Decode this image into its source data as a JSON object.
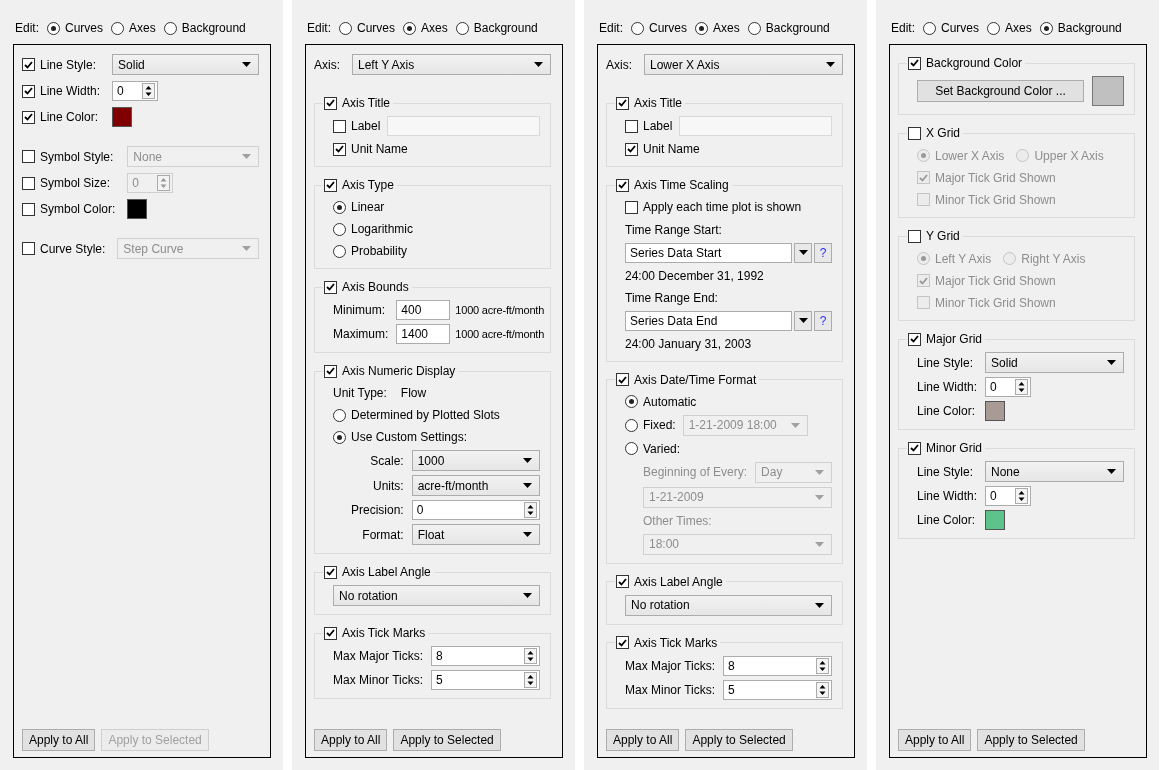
{
  "panels": [
    {
      "edit_label": "Edit:",
      "edit_options": [
        {
          "label": "Curves",
          "selected": true
        },
        {
          "label": "Axes",
          "selected": false
        },
        {
          "label": "Background",
          "selected": false
        }
      ],
      "blocks": [
        {
          "kind": "plain",
          "items": [
            {
              "kind": "dropdown",
              "label": "Line Style:",
              "checked": true,
              "value": "Solid",
              "disabled": false
            },
            {
              "kind": "spinner",
              "label": "Line Width:",
              "checked": true,
              "value": "0",
              "disabled": false
            },
            {
              "kind": "color",
              "label": "Line Color:",
              "checked": true,
              "color": "#800000",
              "disabled": false
            }
          ]
        },
        {
          "kind": "plain",
          "items": [
            {
              "kind": "dropdown",
              "label": "Symbol Style:",
              "checked": false,
              "value": "None",
              "disabled": true
            },
            {
              "kind": "spinner",
              "label": "Symbol Size:",
              "checked": false,
              "value": "0",
              "disabled": true
            },
            {
              "kind": "color",
              "label": "Symbol Color:",
              "checked": false,
              "color": "#000000",
              "disabled": false
            }
          ]
        },
        {
          "kind": "plain",
          "items": [
            {
              "kind": "dropdown",
              "label": "Curve Style:",
              "checked": false,
              "value": "Step Curve",
              "disabled": true
            }
          ]
        }
      ],
      "buttons": [
        {
          "label": "Apply to All",
          "disabled": false
        },
        {
          "label": "Apply to Selected",
          "disabled": true
        }
      ]
    },
    {
      "edit_label": "Edit:",
      "edit_options": [
        {
          "label": "Curves",
          "selected": false
        },
        {
          "label": "Axes",
          "selected": true
        },
        {
          "label": "Background",
          "selected": false
        }
      ],
      "blocks": [
        {
          "kind": "plain",
          "items": [
            {
              "kind": "dropdown",
              "label": "Axis:",
              "value": "Left Y Axis",
              "disabled": false
            }
          ]
        },
        {
          "kind": "group",
          "title": "Axis Title",
          "checked": true,
          "items": [
            {
              "kind": "check_field",
              "label": "Label",
              "checked": false,
              "disabled": false
            },
            {
              "kind": "check",
              "label": "Unit Name",
              "checked": true,
              "disabled": false
            }
          ]
        },
        {
          "kind": "group",
          "title": "Axis Type",
          "checked": true,
          "items": [
            {
              "kind": "radio",
              "label": "Linear",
              "selected": true,
              "disabled": false
            },
            {
              "kind": "radio",
              "label": "Logarithmic",
              "selected": false,
              "disabled": false
            },
            {
              "kind": "radio",
              "label": "Probability",
              "selected": false,
              "disabled": false
            }
          ]
        },
        {
          "kind": "group",
          "title": "Axis Bounds",
          "checked": true,
          "items": [
            {
              "kind": "bound",
              "label": "Minimum:",
              "value": "400",
              "unit": "1000 acre-ft/month",
              "disabled": false
            },
            {
              "kind": "bound",
              "label": "Maximum:",
              "value": "1400",
              "unit": "1000 acre-ft/month",
              "disabled": false
            }
          ]
        },
        {
          "kind": "group",
          "title": "Axis Numeric Display",
          "checked": true,
          "items": [
            {
              "kind": "info",
              "label": "Unit Type:",
              "value": "Flow",
              "disabled": false
            },
            {
              "kind": "radio",
              "label": "Determined by Plotted Slots",
              "selected": false,
              "disabled": false
            },
            {
              "kind": "radio",
              "label": "Use Custom Settings:",
              "selected": true,
              "disabled": false,
              "children": [
                {
                  "kind": "dropdown",
                  "label": "Scale:",
                  "value": "1000",
                  "disabled": false
                },
                {
                  "kind": "dropdown",
                  "label": "Units:",
                  "value": "acre-ft/month",
                  "disabled": false
                },
                {
                  "kind": "number_field",
                  "label": "Precision:",
                  "value": "0",
                  "disabled": false
                },
                {
                  "kind": "dropdown",
                  "label": "Format:",
                  "value": "Float",
                  "disabled": false
                }
              ]
            }
          ]
        },
        {
          "kind": "group",
          "title": "Axis Label Angle",
          "checked": true,
          "items": [
            {
              "kind": "dropdown",
              "value": "No rotation",
              "disabled": false
            }
          ]
        },
        {
          "kind": "group",
          "title": "Axis Tick Marks",
          "checked": true,
          "items": [
            {
              "kind": "number_field",
              "label": "Max Major Ticks:",
              "value": "8",
              "disabled": false
            },
            {
              "kind": "number_field",
              "label": "Max Minor Ticks:",
              "value": "5",
              "disabled": false
            }
          ]
        }
      ],
      "buttons": [
        {
          "label": "Apply to All",
          "disabled": false
        },
        {
          "label": "Apply to Selected",
          "disabled": false
        }
      ]
    },
    {
      "edit_label": "Edit:",
      "edit_options": [
        {
          "label": "Curves",
          "selected": false
        },
        {
          "label": "Axes",
          "selected": true
        },
        {
          "label": "Background",
          "selected": false
        }
      ],
      "blocks": [
        {
          "kind": "plain",
          "items": [
            {
              "kind": "dropdown",
              "label": "Axis:",
              "value": "Lower X Axis",
              "disabled": false
            }
          ]
        },
        {
          "kind": "group",
          "title": "Axis Title",
          "checked": true,
          "items": [
            {
              "kind": "check_field",
              "label": "Label",
              "checked": false,
              "disabled": false
            },
            {
              "kind": "check",
              "label": "Unit Name",
              "checked": true,
              "disabled": false
            }
          ]
        },
        {
          "kind": "group",
          "title": "Axis Time Scaling",
          "checked": true,
          "items": [
            {
              "kind": "check",
              "label": "Apply each time plot is shown",
              "checked": false,
              "disabled": false
            },
            {
              "kind": "text",
              "text": "Time Range Start:",
              "disabled": false
            },
            {
              "kind": "combo",
              "value": "Series Data Start",
              "help": "?",
              "disabled": false
            },
            {
              "kind": "text",
              "text": "24:00 December 31, 1992",
              "disabled": false
            },
            {
              "kind": "text",
              "text": "Time Range End:",
              "disabled": false
            },
            {
              "kind": "combo",
              "value": "Series Data End",
              "help": "?",
              "disabled": false
            },
            {
              "kind": "text",
              "text": "24:00 January 31, 2003",
              "disabled": false
            }
          ]
        },
        {
          "kind": "group",
          "title": "Axis Date/Time Format",
          "checked": true,
          "items": [
            {
              "kind": "radio",
              "label": "Automatic",
              "selected": true,
              "disabled": false
            },
            {
              "kind": "radio",
              "label": "Fixed:",
              "selected": false,
              "disabled": false,
              "select": {
                "value": "1-21-2009 18:00",
                "disabled": true
              }
            },
            {
              "kind": "radio",
              "label": "Varied:",
              "selected": false,
              "disabled": false,
              "children": [
                {
                  "kind": "dropdown",
                  "label": "Beginning of Every:",
                  "value": "Day",
                  "disabled": true
                },
                {
                  "kind": "dropdown",
                  "value": "1-21-2009",
                  "disabled": true
                },
                {
                  "kind": "text",
                  "text": "Other Times:",
                  "disabled": true
                },
                {
                  "kind": "dropdown",
                  "value": "18:00",
                  "disabled": true
                }
              ]
            }
          ]
        },
        {
          "kind": "group",
          "title": "Axis Label Angle",
          "checked": true,
          "items": [
            {
              "kind": "dropdown",
              "value": "No rotation",
              "disabled": false
            }
          ]
        },
        {
          "kind": "group",
          "title": "Axis Tick Marks",
          "checked": true,
          "items": [
            {
              "kind": "number_field",
              "label": "Max Major Ticks:",
              "value": "8",
              "disabled": false
            },
            {
              "kind": "number_field",
              "label": "Max Minor Ticks:",
              "value": "5",
              "disabled": false
            }
          ]
        }
      ],
      "buttons": [
        {
          "label": "Apply to All",
          "disabled": false
        },
        {
          "label": "Apply to Selected",
          "disabled": false
        }
      ]
    },
    {
      "edit_label": "Edit:",
      "edit_options": [
        {
          "label": "Curves",
          "selected": false
        },
        {
          "label": "Axes",
          "selected": false
        },
        {
          "label": "Background",
          "selected": true
        }
      ],
      "blocks": [
        {
          "kind": "group",
          "title": "Background Color",
          "checked": true,
          "items": [
            {
              "kind": "button_color",
              "button": "Set Background Color ...",
              "color": "#c0c0c0",
              "disabled": false
            }
          ]
        },
        {
          "kind": "group",
          "title": "X Grid",
          "checked": false,
          "items": [
            {
              "kind": "radio_pair",
              "options": [
                {
                  "label": "Lower X Axis",
                  "selected": true
                },
                {
                  "label": "Upper X Axis",
                  "selected": false
                }
              ],
              "disabled": true
            },
            {
              "kind": "check",
              "label": "Major Tick Grid Shown",
              "checked": true,
              "disabled": true
            },
            {
              "kind": "check",
              "label": "Minor Tick Grid Shown",
              "checked": false,
              "disabled": true
            }
          ]
        },
        {
          "kind": "group",
          "title": "Y Grid",
          "checked": false,
          "items": [
            {
              "kind": "radio_pair",
              "options": [
                {
                  "label": "Left Y Axis",
                  "selected": true
                },
                {
                  "label": "Right Y Axis",
                  "selected": false
                }
              ],
              "disabled": true
            },
            {
              "kind": "check",
              "label": "Major Tick Grid Shown",
              "checked": true,
              "disabled": true
            },
            {
              "kind": "check",
              "label": "Minor Tick Grid Shown",
              "checked": false,
              "disabled": true
            }
          ]
        },
        {
          "kind": "group",
          "title": "Major Grid",
          "checked": true,
          "items": [
            {
              "kind": "dropdown",
              "label": "Line Style:",
              "value": "Solid",
              "disabled": false
            },
            {
              "kind": "spinner",
              "label": "Line Width:",
              "value": "0",
              "disabled": false
            },
            {
              "kind": "color",
              "label": "Line Color:",
              "color": "#a89a94",
              "disabled": false
            }
          ]
        },
        {
          "kind": "group",
          "title": "Minor Grid",
          "checked": true,
          "items": [
            {
              "kind": "dropdown",
              "label": "Line Style:",
              "value": "None",
              "disabled": false
            },
            {
              "kind": "spinner",
              "label": "Line Width:",
              "value": "0",
              "disabled": false
            },
            {
              "kind": "color",
              "label": "Line Color:",
              "color": "#5cc48a",
              "disabled": false
            }
          ]
        }
      ],
      "buttons": [
        {
          "label": "Apply to All",
          "disabled": false
        },
        {
          "label": "Apply to Selected",
          "disabled": false
        }
      ]
    }
  ]
}
